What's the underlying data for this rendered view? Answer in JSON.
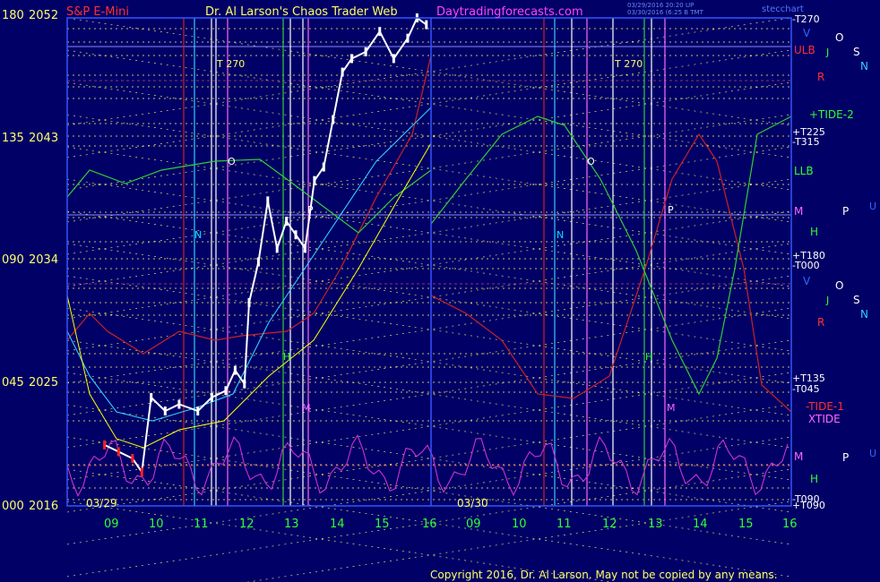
{
  "chart_data": {
    "type": "line",
    "header": {
      "left_label": "S&P E-Mini",
      "title": "Dr. Al Larson's Chaos Trader Web",
      "site": "Daytradingforecasts.com",
      "stamp_line1": "03/29/2016 20:20 UP",
      "stamp_line2": "03/30/2016 (6:25 B TMT",
      "right_label": "stecchart"
    },
    "y_left_ticks": [
      "180",
      "135",
      "090",
      "045",
      "000"
    ],
    "y_price_ticks": [
      "2052",
      "2043",
      "2034",
      "2025",
      "2016"
    ],
    "x_ticks_day1": [
      "09",
      "10",
      "11",
      "12",
      "13",
      "14",
      "15",
      "16"
    ],
    "x_ticks_day2": [
      "09",
      "10",
      "11",
      "12",
      "13",
      "14",
      "15",
      "16"
    ],
    "dates": [
      "03/29",
      "03/30"
    ],
    "right_labels": [
      {
        "text": "-T270",
        "color": "#ffffff"
      },
      {
        "text": "ULB",
        "color": "#ff3030"
      },
      {
        "text": "+TIDE-2",
        "color": "#33ff33"
      },
      {
        "text": "+T225",
        "color": "#ffffff"
      },
      {
        "text": "-T315",
        "color": "#ffffff"
      },
      {
        "text": "LLB",
        "color": "#33ff33"
      },
      {
        "text": "M",
        "color": "#ff66ff"
      },
      {
        "text": "H",
        "color": "#33ff33"
      },
      {
        "text": "+T180",
        "color": "#ffffff"
      },
      {
        "text": "-T000",
        "color": "#ffffff"
      },
      {
        "text": "+T135",
        "color": "#ffffff"
      },
      {
        "text": "-T045",
        "color": "#ffffff"
      },
      {
        "text": "-TIDE-1",
        "color": "#ff3030"
      },
      {
        "text": "XTIDE",
        "color": "#ff66ff"
      },
      {
        "text": "M",
        "color": "#ff66ff"
      },
      {
        "text": "H",
        "color": "#33ff33"
      },
      {
        "text": "-T090",
        "color": "#ffffff"
      },
      {
        "text": "+T090",
        "color": "#ffffff"
      }
    ],
    "planet_glyphs_top": [
      "V",
      "O",
      "J",
      "S",
      "N",
      "R",
      "P",
      "U"
    ],
    "planet_glyphs_bottom": [
      "V",
      "O",
      "J",
      "S",
      "N",
      "R",
      "P",
      "U"
    ],
    "in_chart_markers": [
      {
        "text": "T 270",
        "color": "#ffff66"
      },
      {
        "text": "T 270",
        "color": "#ffff66"
      },
      {
        "text": "O",
        "color": "#ffffff"
      },
      {
        "text": "O",
        "color": "#ffffff"
      },
      {
        "text": "N",
        "color": "#00e0ff"
      },
      {
        "text": "N",
        "color": "#00e0ff"
      },
      {
        "text": "P",
        "color": "#ffffff"
      },
      {
        "text": "P",
        "color": "#ffffff"
      },
      {
        "text": "M",
        "color": "#ff66ff"
      },
      {
        "text": "M",
        "color": "#ff66ff"
      },
      {
        "text": "H",
        "color": "#33ff33"
      },
      {
        "text": "H",
        "color": "#33ff33"
      }
    ],
    "price_series": {
      "name": "S&P E-Mini",
      "x": [
        9.0,
        9.3,
        9.6,
        9.8,
        10.0,
        10.3,
        10.6,
        11.0,
        11.3,
        11.6,
        11.8,
        12.0,
        12.1,
        12.3,
        12.5,
        12.7,
        12.9,
        13.1,
        13.3,
        13.5,
        13.7,
        13.9,
        14.1,
        14.3,
        14.6,
        14.9,
        15.2,
        15.5,
        15.7,
        15.9
      ],
      "y": [
        2020.5,
        2020.0,
        2019.5,
        2018.5,
        2024.0,
        2023.0,
        2023.5,
        2023.0,
        2024.0,
        2024.5,
        2026.0,
        2025.0,
        2031.0,
        2034.0,
        2038.5,
        2035.0,
        2037.0,
        2036.0,
        2035.0,
        2040.0,
        2041.0,
        2044.5,
        2048.0,
        2049.0,
        2049.5,
        2051.0,
        2049.0,
        2050.5,
        2052.0,
        2051.5
      ]
    },
    "colors": {
      "background": "#000066",
      "frame": "#3355ff",
      "grid_dotted": "#ffff66",
      "price": "#ffffff",
      "low_price": "#ff2020",
      "ma_yellow": "#ffff00",
      "ma_cyan": "#33ccff",
      "tide_green": "#33cc33",
      "tide_red": "#cc2222",
      "xtide": "#cc33cc"
    },
    "copyright": "Copyright 2016, Dr. Al Larson. May not be copied by any means."
  }
}
